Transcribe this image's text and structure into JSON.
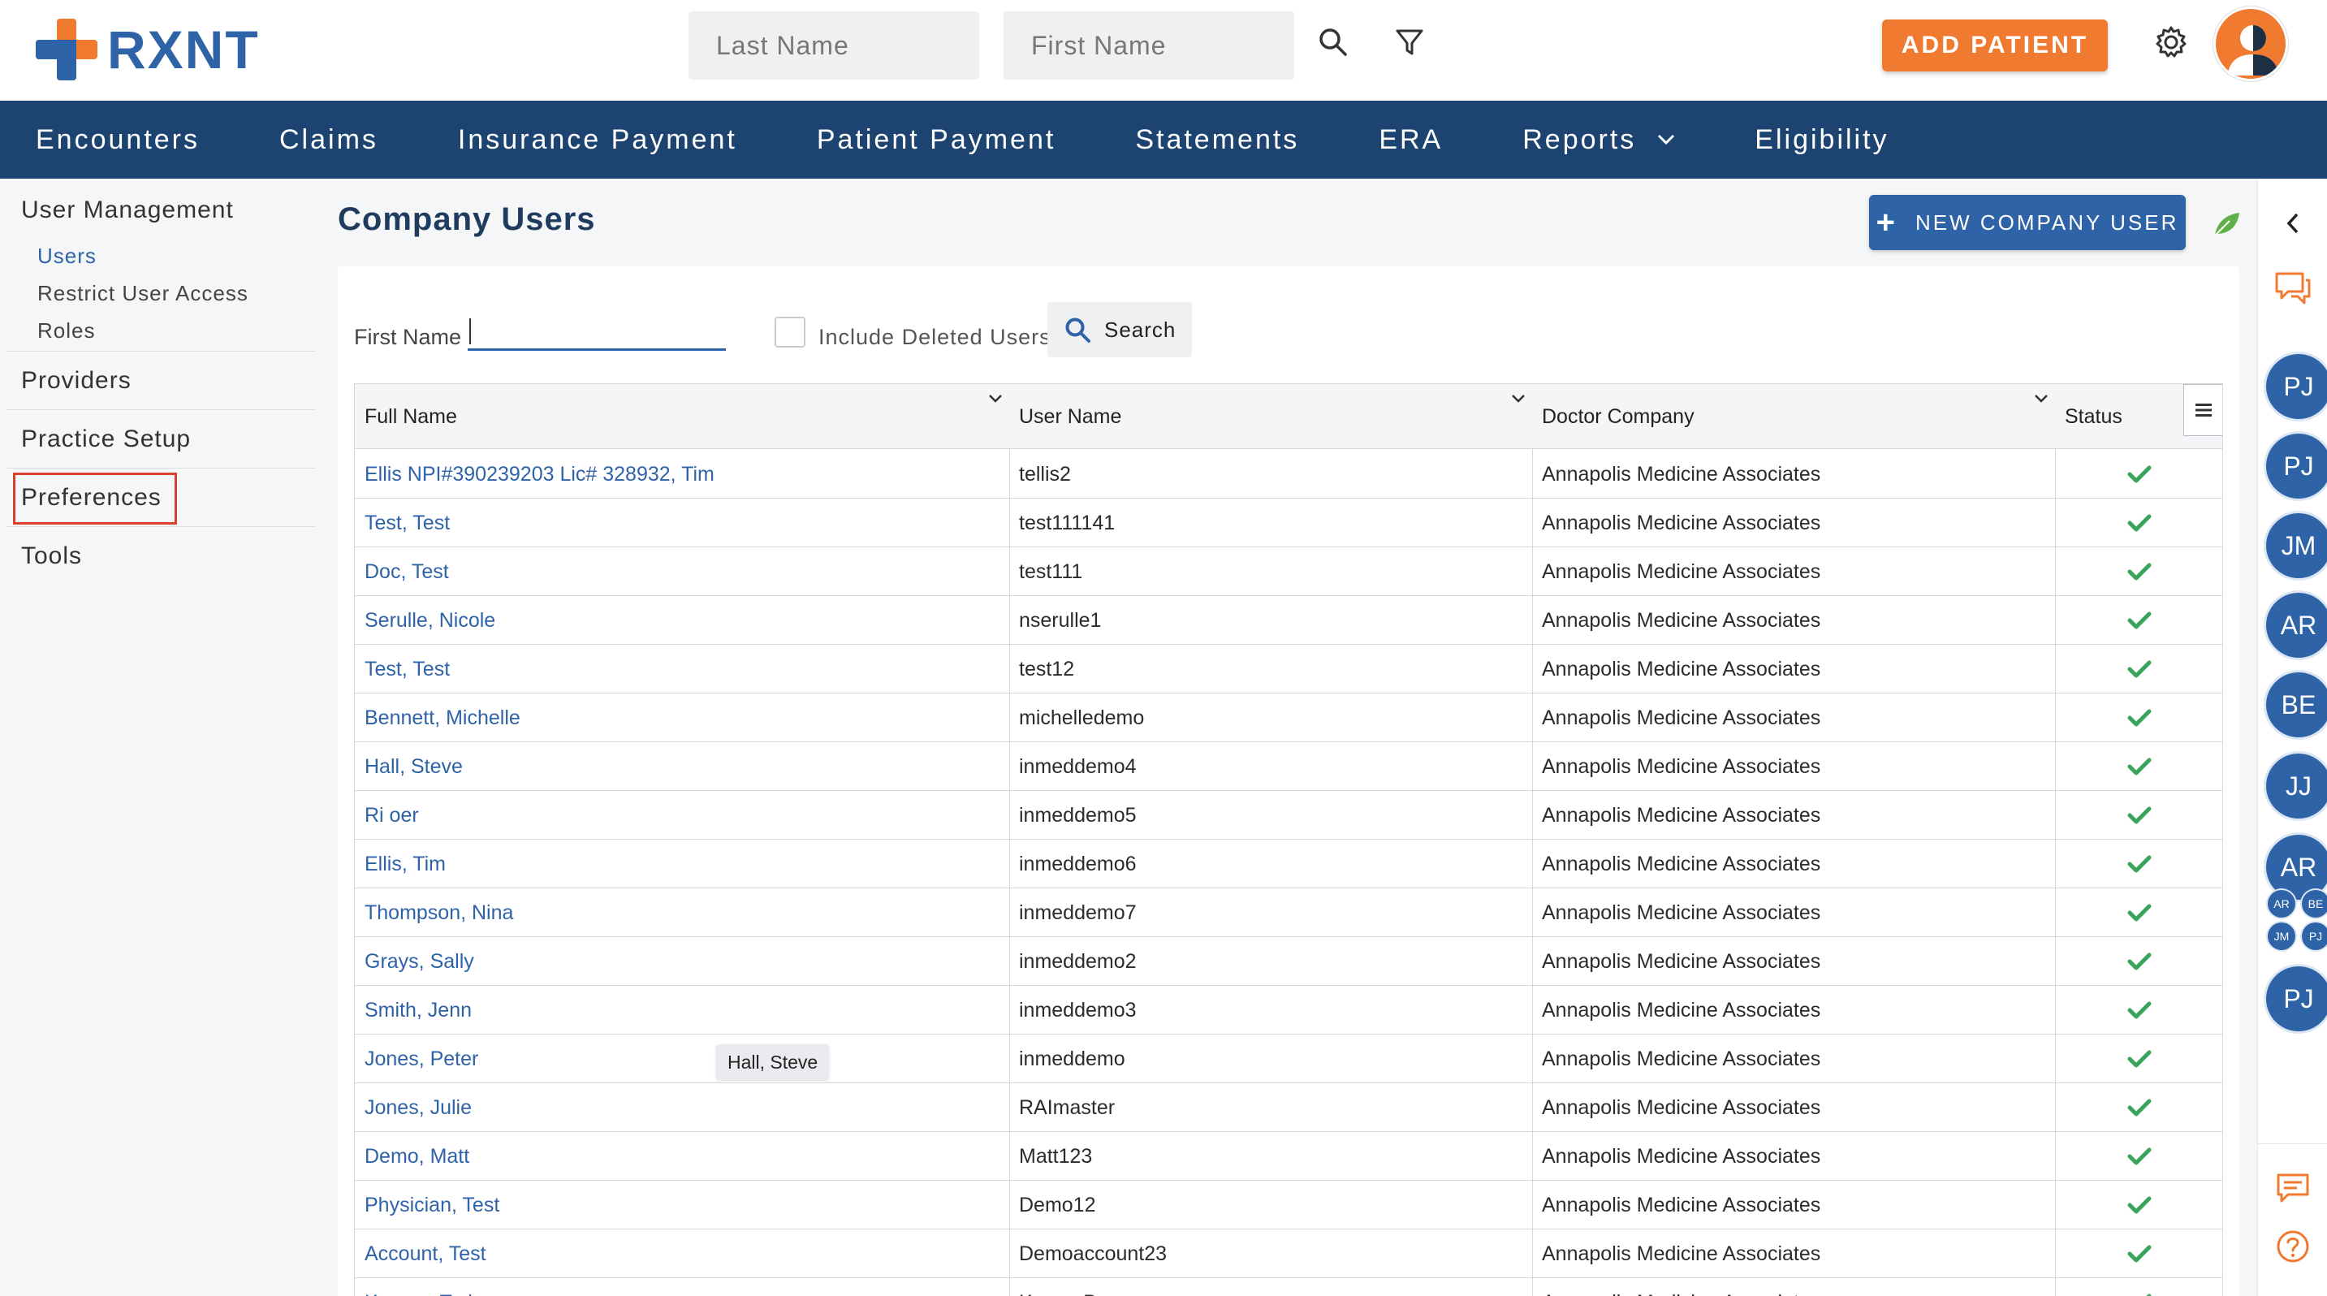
{
  "header": {
    "logo_text": "RXNT",
    "last_name_placeholder": "Last Name",
    "first_name_placeholder": "First Name",
    "add_patient_label": "ADD PATIENT"
  },
  "nav": {
    "items": [
      "Encounters",
      "Claims",
      "Insurance Payment",
      "Patient Payment",
      "Statements",
      "ERA",
      "Reports",
      "Eligibility"
    ]
  },
  "sidebar": {
    "user_management": "User Management",
    "users": "Users",
    "restrict_user_access": "Restrict User Access",
    "roles": "Roles",
    "providers": "Providers",
    "practice_setup": "Practice Setup",
    "preferences": "Preferences",
    "tools": "Tools"
  },
  "main": {
    "title": "Company Users",
    "new_user_label": "NEW COMPANY USER",
    "first_name_label": "First Name",
    "include_deleted_label": "Include Deleted Users",
    "search_label": "Search"
  },
  "table": {
    "columns": [
      "Full Name",
      "User Name",
      "Doctor Company",
      "Status"
    ],
    "rows": [
      {
        "name": "Ellis NPI#390239203 Lic# 328932, Tim",
        "user": "tellis2",
        "company": "Annapolis Medicine Associates"
      },
      {
        "name": "Test, Test",
        "user": "test111141",
        "company": "Annapolis Medicine Associates"
      },
      {
        "name": "Doc, Test",
        "user": "test111",
        "company": "Annapolis Medicine Associates"
      },
      {
        "name": "Serulle, Nicole",
        "user": "nserulle1",
        "company": "Annapolis Medicine Associates"
      },
      {
        "name": "Test, Test",
        "user": "test12",
        "company": "Annapolis Medicine Associates"
      },
      {
        "name": "Bennett, Michelle",
        "user": "michelledemo",
        "company": "Annapolis Medicine Associates"
      },
      {
        "name": "Hall, Steve",
        "user": "inmeddemo4",
        "company": "Annapolis Medicine Associates"
      },
      {
        "name": "Ri            oer",
        "user": "inmeddemo5",
        "company": "Annapolis Medicine Associates"
      },
      {
        "name": "Ellis, Tim",
        "user": "inmeddemo6",
        "company": "Annapolis Medicine Associates"
      },
      {
        "name": "Thompson, Nina",
        "user": "inmeddemo7",
        "company": "Annapolis Medicine Associates"
      },
      {
        "name": "Grays, Sally",
        "user": "inmeddemo2",
        "company": "Annapolis Medicine Associates"
      },
      {
        "name": "Smith, Jenn",
        "user": "inmeddemo3",
        "company": "Annapolis Medicine Associates"
      },
      {
        "name": "Jones, Peter",
        "user": "inmeddemo",
        "company": "Annapolis Medicine Associates"
      },
      {
        "name": "Jones, Julie",
        "user": "RAImaster",
        "company": "Annapolis Medicine Associates"
      },
      {
        "name": "Demo, Matt",
        "user": "Matt123",
        "company": "Annapolis Medicine Associates"
      },
      {
        "name": "Physician, Test",
        "user": "Demo12",
        "company": "Annapolis Medicine Associates"
      },
      {
        "name": "Account, Test",
        "user": "Demoaccount23",
        "company": "Annapolis Medicine Associates"
      },
      {
        "name": "Kepros, Ted",
        "user": "KeprosDemo",
        "company": "Annapolis Medicine Associates"
      }
    ],
    "tooltip": "Hall, Steve"
  },
  "rail": {
    "avatars": [
      "PJ",
      "PJ",
      "JM",
      "AR",
      "BE",
      "JJ",
      "AR"
    ],
    "mini_avatars": [
      "AR",
      "BE",
      "JM",
      "PJ"
    ],
    "last_avatar": "PJ"
  },
  "colors": {
    "brand_blue": "#2f63a8",
    "nav_bg": "#1d4471",
    "accent_orange": "#f07a30",
    "status_green": "#3aa45c",
    "highlight_red": "#d9402e"
  }
}
